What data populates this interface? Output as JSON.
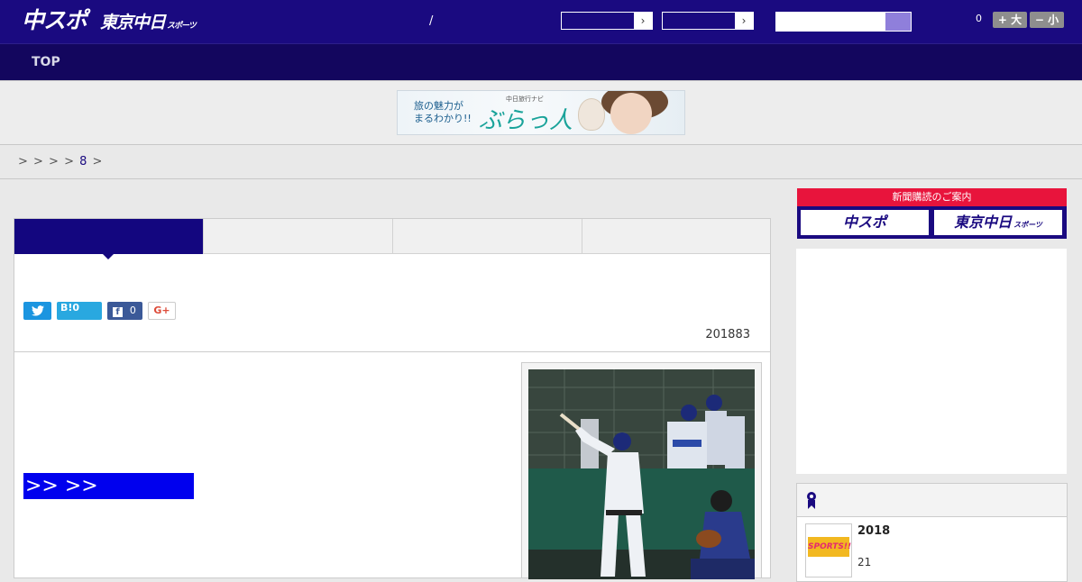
{
  "header": {
    "logo_chunichi": "中スポ",
    "logo_tokyo": "東京中日",
    "logo_tokyo_sub": "スポーツ",
    "separator": "/",
    "font_count": "0",
    "font_plus": "+ 大",
    "font_minus": "− 小"
  },
  "nav": {
    "top": "TOP"
  },
  "ad_banner": {
    "line1": "旅の魅力が",
    "line2": "まるわかり!!",
    "brand_small": "中日旅行ナビ",
    "brand": "ぶらっ人"
  },
  "breadcrumb": {
    "prefix": "> > > > ",
    "num": "8",
    "suffix": " >"
  },
  "share": {
    "hatena": "B!0",
    "facebook_count": "0",
    "gplus": "G+"
  },
  "article": {
    "date": "201883",
    "link": ">> >>"
  },
  "sidebar": {
    "subscribe": "新聞購読のご案内",
    "chunichi": "中スポ",
    "tokyo": "東京中日",
    "tokyo_sub": "スポーツ",
    "item_title": "2018",
    "item_date": "21",
    "thumb_text": "SPORTS!!"
  },
  "colors": {
    "brand": "#1a0a80",
    "nav": "#13065e",
    "link": "#0000ee",
    "subscribe": "#e8143c"
  }
}
